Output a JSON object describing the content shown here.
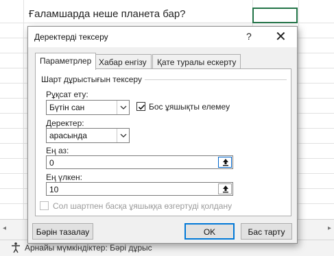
{
  "sheet": {
    "cell_text": "Ғаламшарда неше планета бар?",
    "status_text": "Арнайы мүмкіндіктер: Бәрі дұрыс"
  },
  "dialog": {
    "title": "Деректерді тексеру",
    "help_label": "?",
    "close_label": "✕",
    "tabs": [
      {
        "label": "Параметрлер"
      },
      {
        "label": "Хабар енгізу"
      },
      {
        "label": "Қате туралы ескерту"
      }
    ],
    "section_title": "Шарт дұрыстығын тексеру",
    "allow_label": "Рұқсат ету:",
    "allow_value": "Бүтін сан",
    "ignore_blank_label": "Бос ұяшықты елемеу",
    "data_label": "Деректер:",
    "data_value": "арасында",
    "min_label": "Ең аз:",
    "min_value": "0",
    "max_label": "Ең үлкен:",
    "max_value": "10",
    "apply_all_label": "Сол шартпен басқа ұяшыққа өзгертуді қолдану",
    "clear_all_label": "Бәрін тазалау",
    "ok_label": "OK",
    "cancel_label": "Бас тарту"
  },
  "colors": {
    "accent": "#0078d7",
    "selection_border": "#217346"
  }
}
